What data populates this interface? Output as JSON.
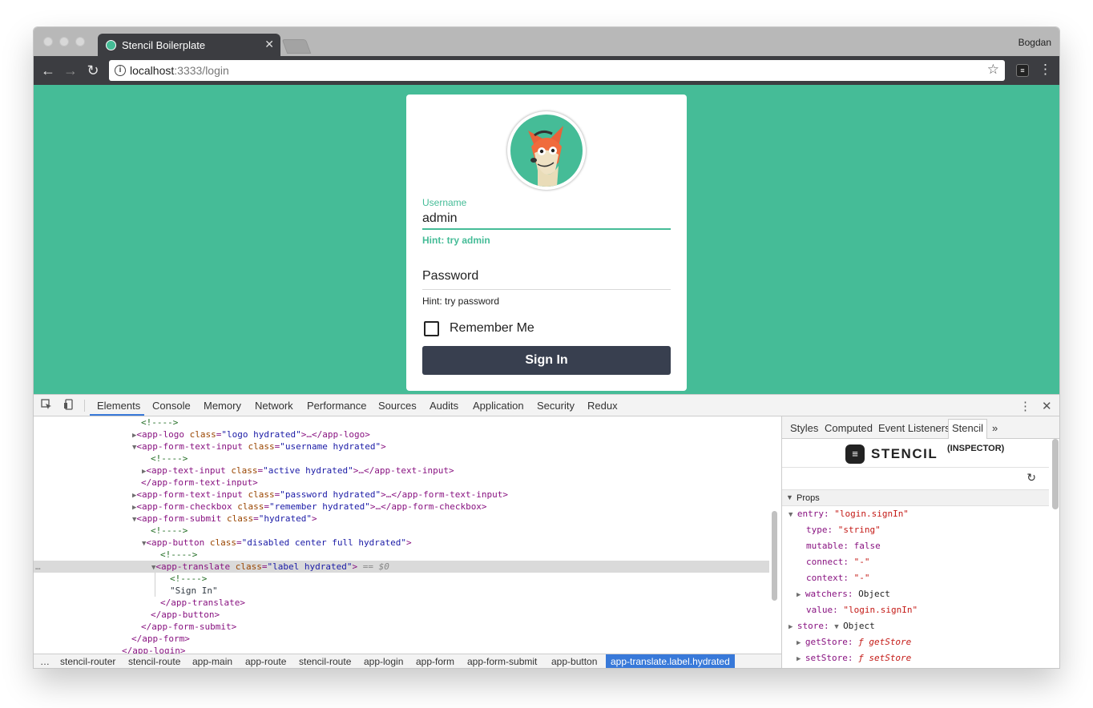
{
  "browser": {
    "tab_title": "Stencil Boilerplate",
    "tab_close": "✕",
    "profile_name": "Bogdan",
    "url_host": "localhost",
    "url_rest": ":3333/login",
    "info_glyph": "i",
    "star_glyph": "☆",
    "back_glyph": "←",
    "forward_glyph": "→",
    "reload_glyph": "↻",
    "menu_glyph": "⋮",
    "ext_glyph": "≡"
  },
  "login": {
    "username_label": "Username",
    "username_value": "admin",
    "username_hint": "Hint: try admin",
    "password_label": "Password",
    "password_hint": "Hint: try password",
    "remember_label": "Remember Me",
    "signin_label": "Sign In",
    "accent_color": "#45bc97",
    "button_color": "#383f4f"
  },
  "devtools": {
    "tabs": [
      "Elements",
      "Console",
      "Memory",
      "Network",
      "Performance",
      "Sources",
      "Audits",
      "Application",
      "Security",
      "Redux"
    ],
    "active_tab": "Elements",
    "more_glyph": "⋮",
    "close_glyph": "✕",
    "dom": {
      "l0": "<!---->",
      "l1_tag": "<app-logo",
      "l1_attr": " class",
      "l1_val": "\"logo hydrated\"",
      "l1_end": ">…</app-logo>",
      "l2_tag": "<app-form-text-input",
      "l2_attr": " class",
      "l2_val": "\"username hydrated\"",
      "l2_end": ">",
      "l3": "<!---->",
      "l4_tag": "<app-text-input",
      "l4_attr": " class",
      "l4_val": "\"active hydrated\"",
      "l4_end": ">…</app-text-input>",
      "l5": "</app-form-text-input>",
      "l6_tag": "<app-form-text-input",
      "l6_attr": " class",
      "l6_val": "\"password hydrated\"",
      "l6_end": ">…</app-form-text-input>",
      "l7_tag": "<app-form-checkbox",
      "l7_attr": " class",
      "l7_val": "\"remember hydrated\"",
      "l7_end": ">…</app-form-checkbox>",
      "l8_tag": "<app-form-submit",
      "l8_attr": " class",
      "l8_val": "\"hydrated\"",
      "l8_end": ">",
      "l9": "<!---->",
      "l10_tag": "<app-button",
      "l10_attr": " class",
      "l10_val": "\"disabled center full hydrated\"",
      "l10_end": ">",
      "l11": "<!---->",
      "l12_tag": "<app-translate",
      "l12_attr": " class",
      "l12_val": "\"label hydrated\"",
      "l12_end": ">",
      "l12_suffix": " == $0",
      "l13": "<!---->",
      "l14": "\"Sign In\"",
      "l15": "</app-translate>",
      "l16": "</app-button>",
      "l17": "</app-form-submit>",
      "l18": "</app-form>",
      "l19": "</app-login>",
      "dots": "…"
    },
    "breadcrumbs": [
      "…",
      "stencil-router",
      "stencil-route",
      "app-main",
      "app-route",
      "stencil-route",
      "app-login",
      "app-form",
      "app-form-submit",
      "app-button"
    ],
    "breadcrumb_active": "app-translate.label.hydrated",
    "sidebar": {
      "tabs": [
        "Styles",
        "Computed",
        "Event Listeners",
        "Stencil"
      ],
      "more": "»",
      "brand_word": "STENCIL",
      "brand_sub": "(INSPECTOR)",
      "refresh_glyph": "↻",
      "props_title": "Props",
      "props": {
        "entry_key": "entry:",
        "entry_val": "\"login.signIn\"",
        "type_key": "type:",
        "type_val": "\"string\"",
        "mutable_key": "mutable:",
        "mutable_val": "false",
        "connect_key": "connect:",
        "connect_val": "\"-\"",
        "context_key": "context:",
        "context_val": "\"-\"",
        "watchers_key": "watchers:",
        "watchers_val": "Object",
        "value_key": "value:",
        "value_val": "\"login.signIn\"",
        "store_key": "store:",
        "store_val": "Object",
        "getstore_key": "getStore:",
        "getstore_val": "ƒ getStore",
        "setstore_key": "setStore:",
        "setstore_val": "ƒ setStore"
      }
    }
  }
}
